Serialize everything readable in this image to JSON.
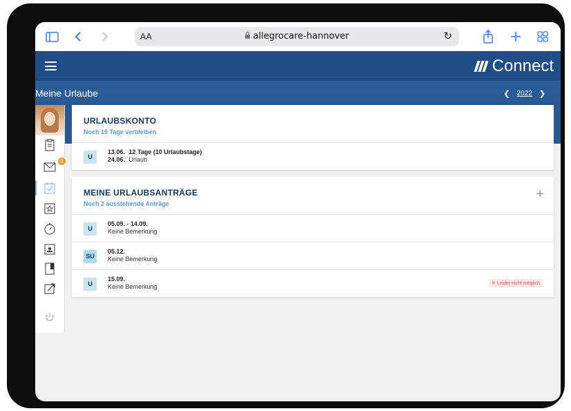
{
  "browser": {
    "text_size_label": "AA",
    "url": "allegrocare-hannover"
  },
  "app": {
    "brand": "Connect",
    "page_title": "Meine Urlaube",
    "year": "2022"
  },
  "sidebar": {
    "messages_badge": "5"
  },
  "urlaubskonto": {
    "title": "URLAUBSKONTO",
    "subtitle": "Noch 19 Tage verbleiben",
    "entry": {
      "tag": "U",
      "date_from": "13.06.",
      "date_to": "24.06.",
      "summary": "12 Tage (10 Urlaubstage)",
      "type": "Urlaub"
    }
  },
  "antraege": {
    "title": "MEINE URLAUBSANTRÄGE",
    "subtitle": "Noch 2 ausstehende Anträge",
    "items": [
      {
        "tag": "U",
        "dates": "05.09. - 14.09.",
        "note": "Keine Bemerkung",
        "status": ""
      },
      {
        "tag": "SU",
        "dates": "05.12.",
        "note": "Keine Bemerkung",
        "status": ""
      },
      {
        "tag": "U",
        "dates": "15.09.",
        "note": "Keine Bemerkung",
        "status": "Leider nicht möglich"
      }
    ]
  },
  "colors": {
    "header": "#1f4e86",
    "accent": "#5b9bd5",
    "tag_bg": "#c6e5ef",
    "status_red": "#e05656",
    "badge": "#f39a26"
  }
}
